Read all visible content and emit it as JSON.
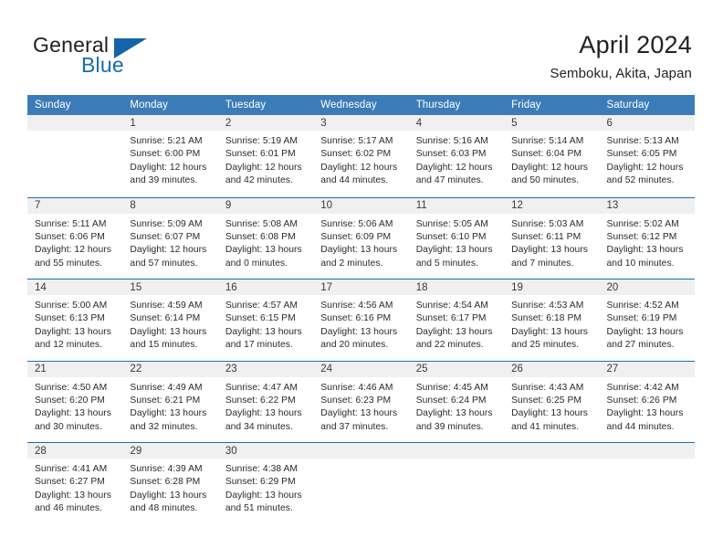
{
  "brand": {
    "name_part1": "General",
    "name_part2": "Blue",
    "logo_icon": "blue-triangle-icon"
  },
  "header": {
    "month_title": "April 2024",
    "location": "Semboku, Akita, Japan"
  },
  "colors": {
    "header_blue": "#3b7cb8",
    "separator_blue": "#1f6cb0",
    "daynum_band": "#f0f0f0",
    "brand_blue": "#156cb0",
    "text": "#222222"
  },
  "calendar": {
    "day_headers": [
      "Sunday",
      "Monday",
      "Tuesday",
      "Wednesday",
      "Thursday",
      "Friday",
      "Saturday"
    ],
    "weeks": [
      [
        {
          "day": "",
          "lines": []
        },
        {
          "day": "1",
          "lines": [
            "Sunrise: 5:21 AM",
            "Sunset: 6:00 PM",
            "Daylight: 12 hours",
            "and 39 minutes."
          ]
        },
        {
          "day": "2",
          "lines": [
            "Sunrise: 5:19 AM",
            "Sunset: 6:01 PM",
            "Daylight: 12 hours",
            "and 42 minutes."
          ]
        },
        {
          "day": "3",
          "lines": [
            "Sunrise: 5:17 AM",
            "Sunset: 6:02 PM",
            "Daylight: 12 hours",
            "and 44 minutes."
          ]
        },
        {
          "day": "4",
          "lines": [
            "Sunrise: 5:16 AM",
            "Sunset: 6:03 PM",
            "Daylight: 12 hours",
            "and 47 minutes."
          ]
        },
        {
          "day": "5",
          "lines": [
            "Sunrise: 5:14 AM",
            "Sunset: 6:04 PM",
            "Daylight: 12 hours",
            "and 50 minutes."
          ]
        },
        {
          "day": "6",
          "lines": [
            "Sunrise: 5:13 AM",
            "Sunset: 6:05 PM",
            "Daylight: 12 hours",
            "and 52 minutes."
          ]
        }
      ],
      [
        {
          "day": "7",
          "lines": [
            "Sunrise: 5:11 AM",
            "Sunset: 6:06 PM",
            "Daylight: 12 hours",
            "and 55 minutes."
          ]
        },
        {
          "day": "8",
          "lines": [
            "Sunrise: 5:09 AM",
            "Sunset: 6:07 PM",
            "Daylight: 12 hours",
            "and 57 minutes."
          ]
        },
        {
          "day": "9",
          "lines": [
            "Sunrise: 5:08 AM",
            "Sunset: 6:08 PM",
            "Daylight: 13 hours",
            "and 0 minutes."
          ]
        },
        {
          "day": "10",
          "lines": [
            "Sunrise: 5:06 AM",
            "Sunset: 6:09 PM",
            "Daylight: 13 hours",
            "and 2 minutes."
          ]
        },
        {
          "day": "11",
          "lines": [
            "Sunrise: 5:05 AM",
            "Sunset: 6:10 PM",
            "Daylight: 13 hours",
            "and 5 minutes."
          ]
        },
        {
          "day": "12",
          "lines": [
            "Sunrise: 5:03 AM",
            "Sunset: 6:11 PM",
            "Daylight: 13 hours",
            "and 7 minutes."
          ]
        },
        {
          "day": "13",
          "lines": [
            "Sunrise: 5:02 AM",
            "Sunset: 6:12 PM",
            "Daylight: 13 hours",
            "and 10 minutes."
          ]
        }
      ],
      [
        {
          "day": "14",
          "lines": [
            "Sunrise: 5:00 AM",
            "Sunset: 6:13 PM",
            "Daylight: 13 hours",
            "and 12 minutes."
          ]
        },
        {
          "day": "15",
          "lines": [
            "Sunrise: 4:59 AM",
            "Sunset: 6:14 PM",
            "Daylight: 13 hours",
            "and 15 minutes."
          ]
        },
        {
          "day": "16",
          "lines": [
            "Sunrise: 4:57 AM",
            "Sunset: 6:15 PM",
            "Daylight: 13 hours",
            "and 17 minutes."
          ]
        },
        {
          "day": "17",
          "lines": [
            "Sunrise: 4:56 AM",
            "Sunset: 6:16 PM",
            "Daylight: 13 hours",
            "and 20 minutes."
          ]
        },
        {
          "day": "18",
          "lines": [
            "Sunrise: 4:54 AM",
            "Sunset: 6:17 PM",
            "Daylight: 13 hours",
            "and 22 minutes."
          ]
        },
        {
          "day": "19",
          "lines": [
            "Sunrise: 4:53 AM",
            "Sunset: 6:18 PM",
            "Daylight: 13 hours",
            "and 25 minutes."
          ]
        },
        {
          "day": "20",
          "lines": [
            "Sunrise: 4:52 AM",
            "Sunset: 6:19 PM",
            "Daylight: 13 hours",
            "and 27 minutes."
          ]
        }
      ],
      [
        {
          "day": "21",
          "lines": [
            "Sunrise: 4:50 AM",
            "Sunset: 6:20 PM",
            "Daylight: 13 hours",
            "and 30 minutes."
          ]
        },
        {
          "day": "22",
          "lines": [
            "Sunrise: 4:49 AM",
            "Sunset: 6:21 PM",
            "Daylight: 13 hours",
            "and 32 minutes."
          ]
        },
        {
          "day": "23",
          "lines": [
            "Sunrise: 4:47 AM",
            "Sunset: 6:22 PM",
            "Daylight: 13 hours",
            "and 34 minutes."
          ]
        },
        {
          "day": "24",
          "lines": [
            "Sunrise: 4:46 AM",
            "Sunset: 6:23 PM",
            "Daylight: 13 hours",
            "and 37 minutes."
          ]
        },
        {
          "day": "25",
          "lines": [
            "Sunrise: 4:45 AM",
            "Sunset: 6:24 PM",
            "Daylight: 13 hours",
            "and 39 minutes."
          ]
        },
        {
          "day": "26",
          "lines": [
            "Sunrise: 4:43 AM",
            "Sunset: 6:25 PM",
            "Daylight: 13 hours",
            "and 41 minutes."
          ]
        },
        {
          "day": "27",
          "lines": [
            "Sunrise: 4:42 AM",
            "Sunset: 6:26 PM",
            "Daylight: 13 hours",
            "and 44 minutes."
          ]
        }
      ],
      [
        {
          "day": "28",
          "lines": [
            "Sunrise: 4:41 AM",
            "Sunset: 6:27 PM",
            "Daylight: 13 hours",
            "and 46 minutes."
          ]
        },
        {
          "day": "29",
          "lines": [
            "Sunrise: 4:39 AM",
            "Sunset: 6:28 PM",
            "Daylight: 13 hours",
            "and 48 minutes."
          ]
        },
        {
          "day": "30",
          "lines": [
            "Sunrise: 4:38 AM",
            "Sunset: 6:29 PM",
            "Daylight: 13 hours",
            "and 51 minutes."
          ]
        },
        {
          "day": "",
          "lines": []
        },
        {
          "day": "",
          "lines": []
        },
        {
          "day": "",
          "lines": []
        },
        {
          "day": "",
          "lines": []
        }
      ]
    ]
  }
}
